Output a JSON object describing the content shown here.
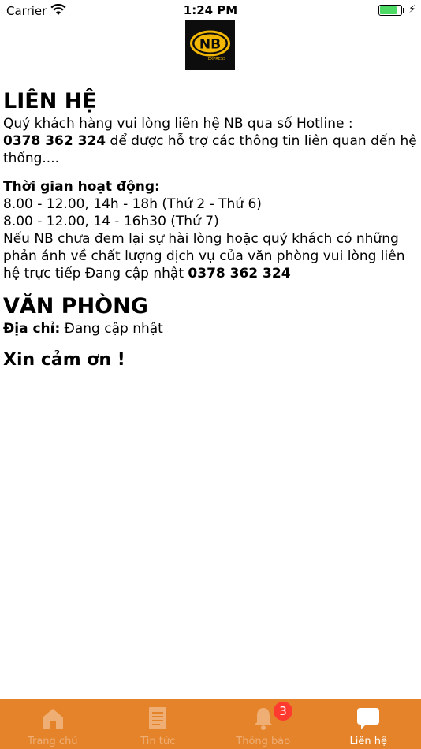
{
  "status_bar": {
    "carrier": "Carrier",
    "time": "1:24 PM"
  },
  "logo": {
    "text": "NB",
    "subtext": "EXPRESS"
  },
  "contact": {
    "title": "LIÊN HỆ",
    "intro_1": "Quý khách hàng vui lòng liên hệ NB qua số Hotline :",
    "hotline": "0378 362 324",
    "intro_2": " để được hỗ trợ các thông tin liên quan đến hệ thống....",
    "hours_title": "Thời gian hoạt động:",
    "hours_1": "8.00 - 12.00, 14h - 18h (Thứ 2 - Thứ 6)",
    "hours_2": "8.00 - 12.00, 14 - 16h30 (Thứ 7)",
    "feedback": "Nếu NB  chưa đem lại sự hài lòng hoặc quý khách có những phản ánh về chất lượng dịch vụ của văn phòng vui lòng liên hệ trực tiếp Đang cập nhật ",
    "feedback_phone": "0378 362 324"
  },
  "office": {
    "title": "VĂN PHÒNG",
    "address_label": "Địa chỉ:",
    "address_value": " Đang cập nhật"
  },
  "thanks": "Xin cảm ơn !",
  "tab_bar": {
    "colors": {
      "background": "#e5832a",
      "active": "#ffffff",
      "badge": "#ff3b30"
    },
    "tabs": [
      {
        "label": "Trang chủ",
        "icon": "home-icon"
      },
      {
        "label": "Tin tức",
        "icon": "document-icon"
      },
      {
        "label": "Thông báo",
        "icon": "bell-icon",
        "badge": "3"
      },
      {
        "label": "Liên hệ",
        "icon": "chat-bubble-icon",
        "active": true
      }
    ]
  }
}
